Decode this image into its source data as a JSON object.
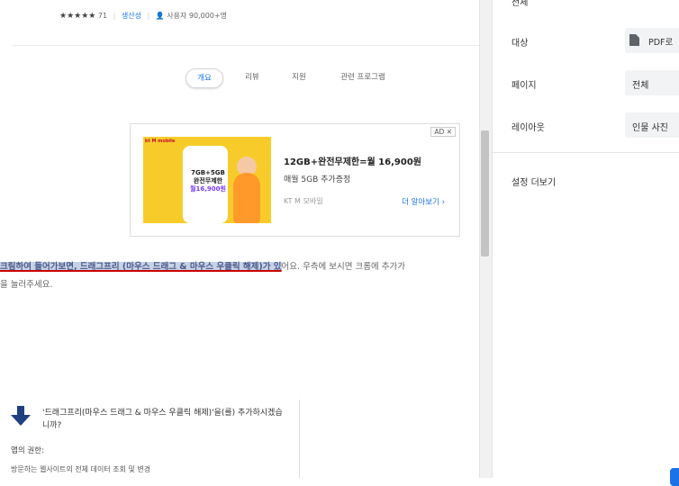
{
  "listing": {
    "stars": "★★★★★",
    "rating_count": "71",
    "category": "생산성",
    "users": "사용자 90,000+명"
  },
  "tabs": [
    {
      "label": "개요"
    },
    {
      "label": "리뷰"
    },
    {
      "label": "지원"
    },
    {
      "label": "관련 프로그램"
    }
  ],
  "ad": {
    "badge": "AD ✕",
    "image_brand": "kt M mobile",
    "image_line1": "7GB+5GB",
    "image_line2": "완전무제한",
    "image_price": "월16,900원",
    "title": "12GB+완전무제한=월 16,900원",
    "subtitle": "매월 5GB 추가증정",
    "brand": "KT M 모바일",
    "more_link": "더 알아보기 ›"
  },
  "article": {
    "highlight_text": "크림하여 들어가보면, 드래그프리 (마우스 드래그 & 마우스 우클릭 해제)가 있",
    "rest_line1": "어요. 우측에 보시면 크롬에 추가가",
    "line2": "을 눌러주세요."
  },
  "dialog": {
    "title": "'드래그프리(마우스 드래그 & 마우스 우클릭 해제)'을(를) 추가하시겠습니까?",
    "permissions_label": "앱의 권한:",
    "permission_item": "방문하는 웹사이트의 전체 데이터 조회 및 변경"
  },
  "print_panel": {
    "top_label": "전체",
    "destination_label": "대상",
    "destination_value": "PDF로",
    "pages_label": "페이지",
    "pages_value": "전체",
    "layout_label": "레이아웃",
    "layout_value": "인물 사진",
    "more_settings": "설정 더보기"
  },
  "colors": {
    "accent": "#1a73e8",
    "ad_image_bg": "#f7cc2a",
    "highlight_bg": "#c7d2e6",
    "underline": "#cc0000",
    "download_arrow": "#1f3f7f"
  }
}
